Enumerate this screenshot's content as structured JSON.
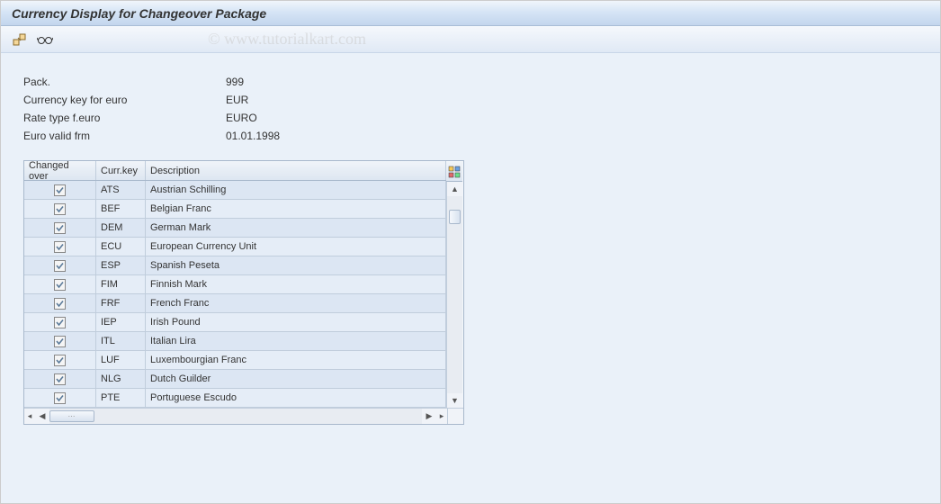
{
  "window": {
    "title": "Currency Display for Changeover Package"
  },
  "watermark": "© www.tutorialkart.com",
  "fields": {
    "pack": {
      "label": "Pack.",
      "value": "999"
    },
    "currency_key": {
      "label": "Currency key for euro",
      "value": "EUR"
    },
    "rate_type": {
      "label": "Rate type f.euro",
      "value": "EURO"
    },
    "valid_from": {
      "label": "Euro valid frm",
      "value": "01.01.1998"
    }
  },
  "table": {
    "headers": {
      "changed_over": "Changed over",
      "curr_key": "Curr.key",
      "description": "Description"
    },
    "rows": [
      {
        "changed": true,
        "key": "ATS",
        "desc": "Austrian Schilling"
      },
      {
        "changed": true,
        "key": "BEF",
        "desc": "Belgian Franc"
      },
      {
        "changed": true,
        "key": "DEM",
        "desc": "German Mark"
      },
      {
        "changed": true,
        "key": "ECU",
        "desc": "European Currency Unit"
      },
      {
        "changed": true,
        "key": "ESP",
        "desc": "Spanish Peseta"
      },
      {
        "changed": true,
        "key": "FIM",
        "desc": "Finnish Mark"
      },
      {
        "changed": true,
        "key": "FRF",
        "desc": "French Franc"
      },
      {
        "changed": true,
        "key": "IEP",
        "desc": "Irish Pound"
      },
      {
        "changed": true,
        "key": "ITL",
        "desc": "Italian Lira"
      },
      {
        "changed": true,
        "key": "LUF",
        "desc": "Luxembourgian Franc"
      },
      {
        "changed": true,
        "key": "NLG",
        "desc": "Dutch Guilder"
      },
      {
        "changed": true,
        "key": "PTE",
        "desc": "Portuguese Escudo"
      }
    ]
  }
}
